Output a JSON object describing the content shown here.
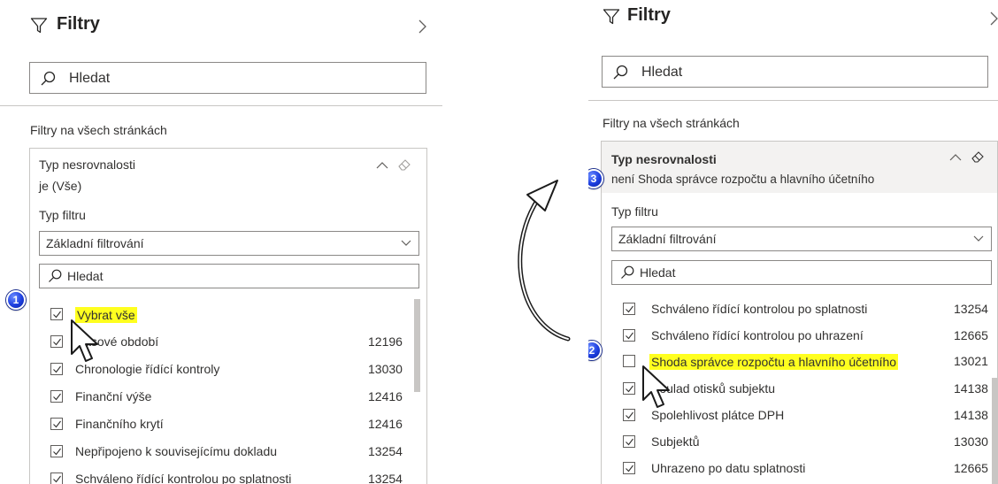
{
  "left": {
    "header": {
      "title": "Filtry"
    },
    "search": {
      "placeholder": "Hledat"
    },
    "section_label": "Filtry na všech stránkách",
    "card": {
      "title": "Typ nesrovnalosti",
      "subtitle": "je (Vše)",
      "filter_type_label": "Typ filtru",
      "filter_type_value": "Základní filtrování",
      "search_placeholder": "Hledat",
      "items": [
        {
          "label": "Vybrat vše",
          "count": "",
          "checked": true,
          "highlighted": true
        },
        {
          "label": "Časové období",
          "count": "12196",
          "checked": true
        },
        {
          "label": "Chronologie řídící kontroly",
          "count": "13030",
          "checked": true
        },
        {
          "label": "Finanční výše",
          "count": "12416",
          "checked": true
        },
        {
          "label": "Finančního krytí",
          "count": "12416",
          "checked": true
        },
        {
          "label": "Nepřipojeno k souvisejícímu dokladu",
          "count": "13254",
          "checked": true
        },
        {
          "label": "Schváleno řídící kontrolou po splatnosti",
          "count": "13254",
          "checked": true
        }
      ]
    },
    "badge": "1"
  },
  "right": {
    "header": {
      "title": "Filtry"
    },
    "search": {
      "placeholder": "Hledat"
    },
    "section_label": "Filtry na všech stránkách",
    "card": {
      "title": "Typ nesrovnalosti",
      "subtitle": "není Shoda správce rozpočtu a hlavního účetního",
      "filter_type_label": "Typ filtru",
      "filter_type_value": "Základní filtrování",
      "search_placeholder": "Hledat",
      "items": [
        {
          "label": "Schváleno řídící kontrolou po splatnosti",
          "count": "13254",
          "checked": true
        },
        {
          "label": "Schváleno řídící kontrolou po uhrazení",
          "count": "12665",
          "checked": true
        },
        {
          "label": "Shoda správce rozpočtu a hlavního účetního",
          "count": "13021",
          "checked": false,
          "highlighted": true
        },
        {
          "label": "Soulad otisků subjektu",
          "count": "14138",
          "checked": true
        },
        {
          "label": "Spolehlivost plátce DPH",
          "count": "14138",
          "checked": true
        },
        {
          "label": "Subjektů",
          "count": "13030",
          "checked": true
        },
        {
          "label": "Uhrazeno po datu splatnosti",
          "count": "12665",
          "checked": true
        }
      ]
    },
    "badge_2": "2",
    "badge_3": "3"
  },
  "colors": {
    "highlight": "#ffff1f",
    "badge": "#1d3fe0",
    "border": "#c8c6c4",
    "text": "#323130"
  },
  "icons": [
    "filter-icon",
    "chevron-right-icon",
    "search-icon",
    "chevron-up-icon",
    "eraser-icon",
    "chevron-down-icon",
    "checkbox-check-icon",
    "mouse-cursor-icon",
    "curved-arrow-icon"
  ]
}
